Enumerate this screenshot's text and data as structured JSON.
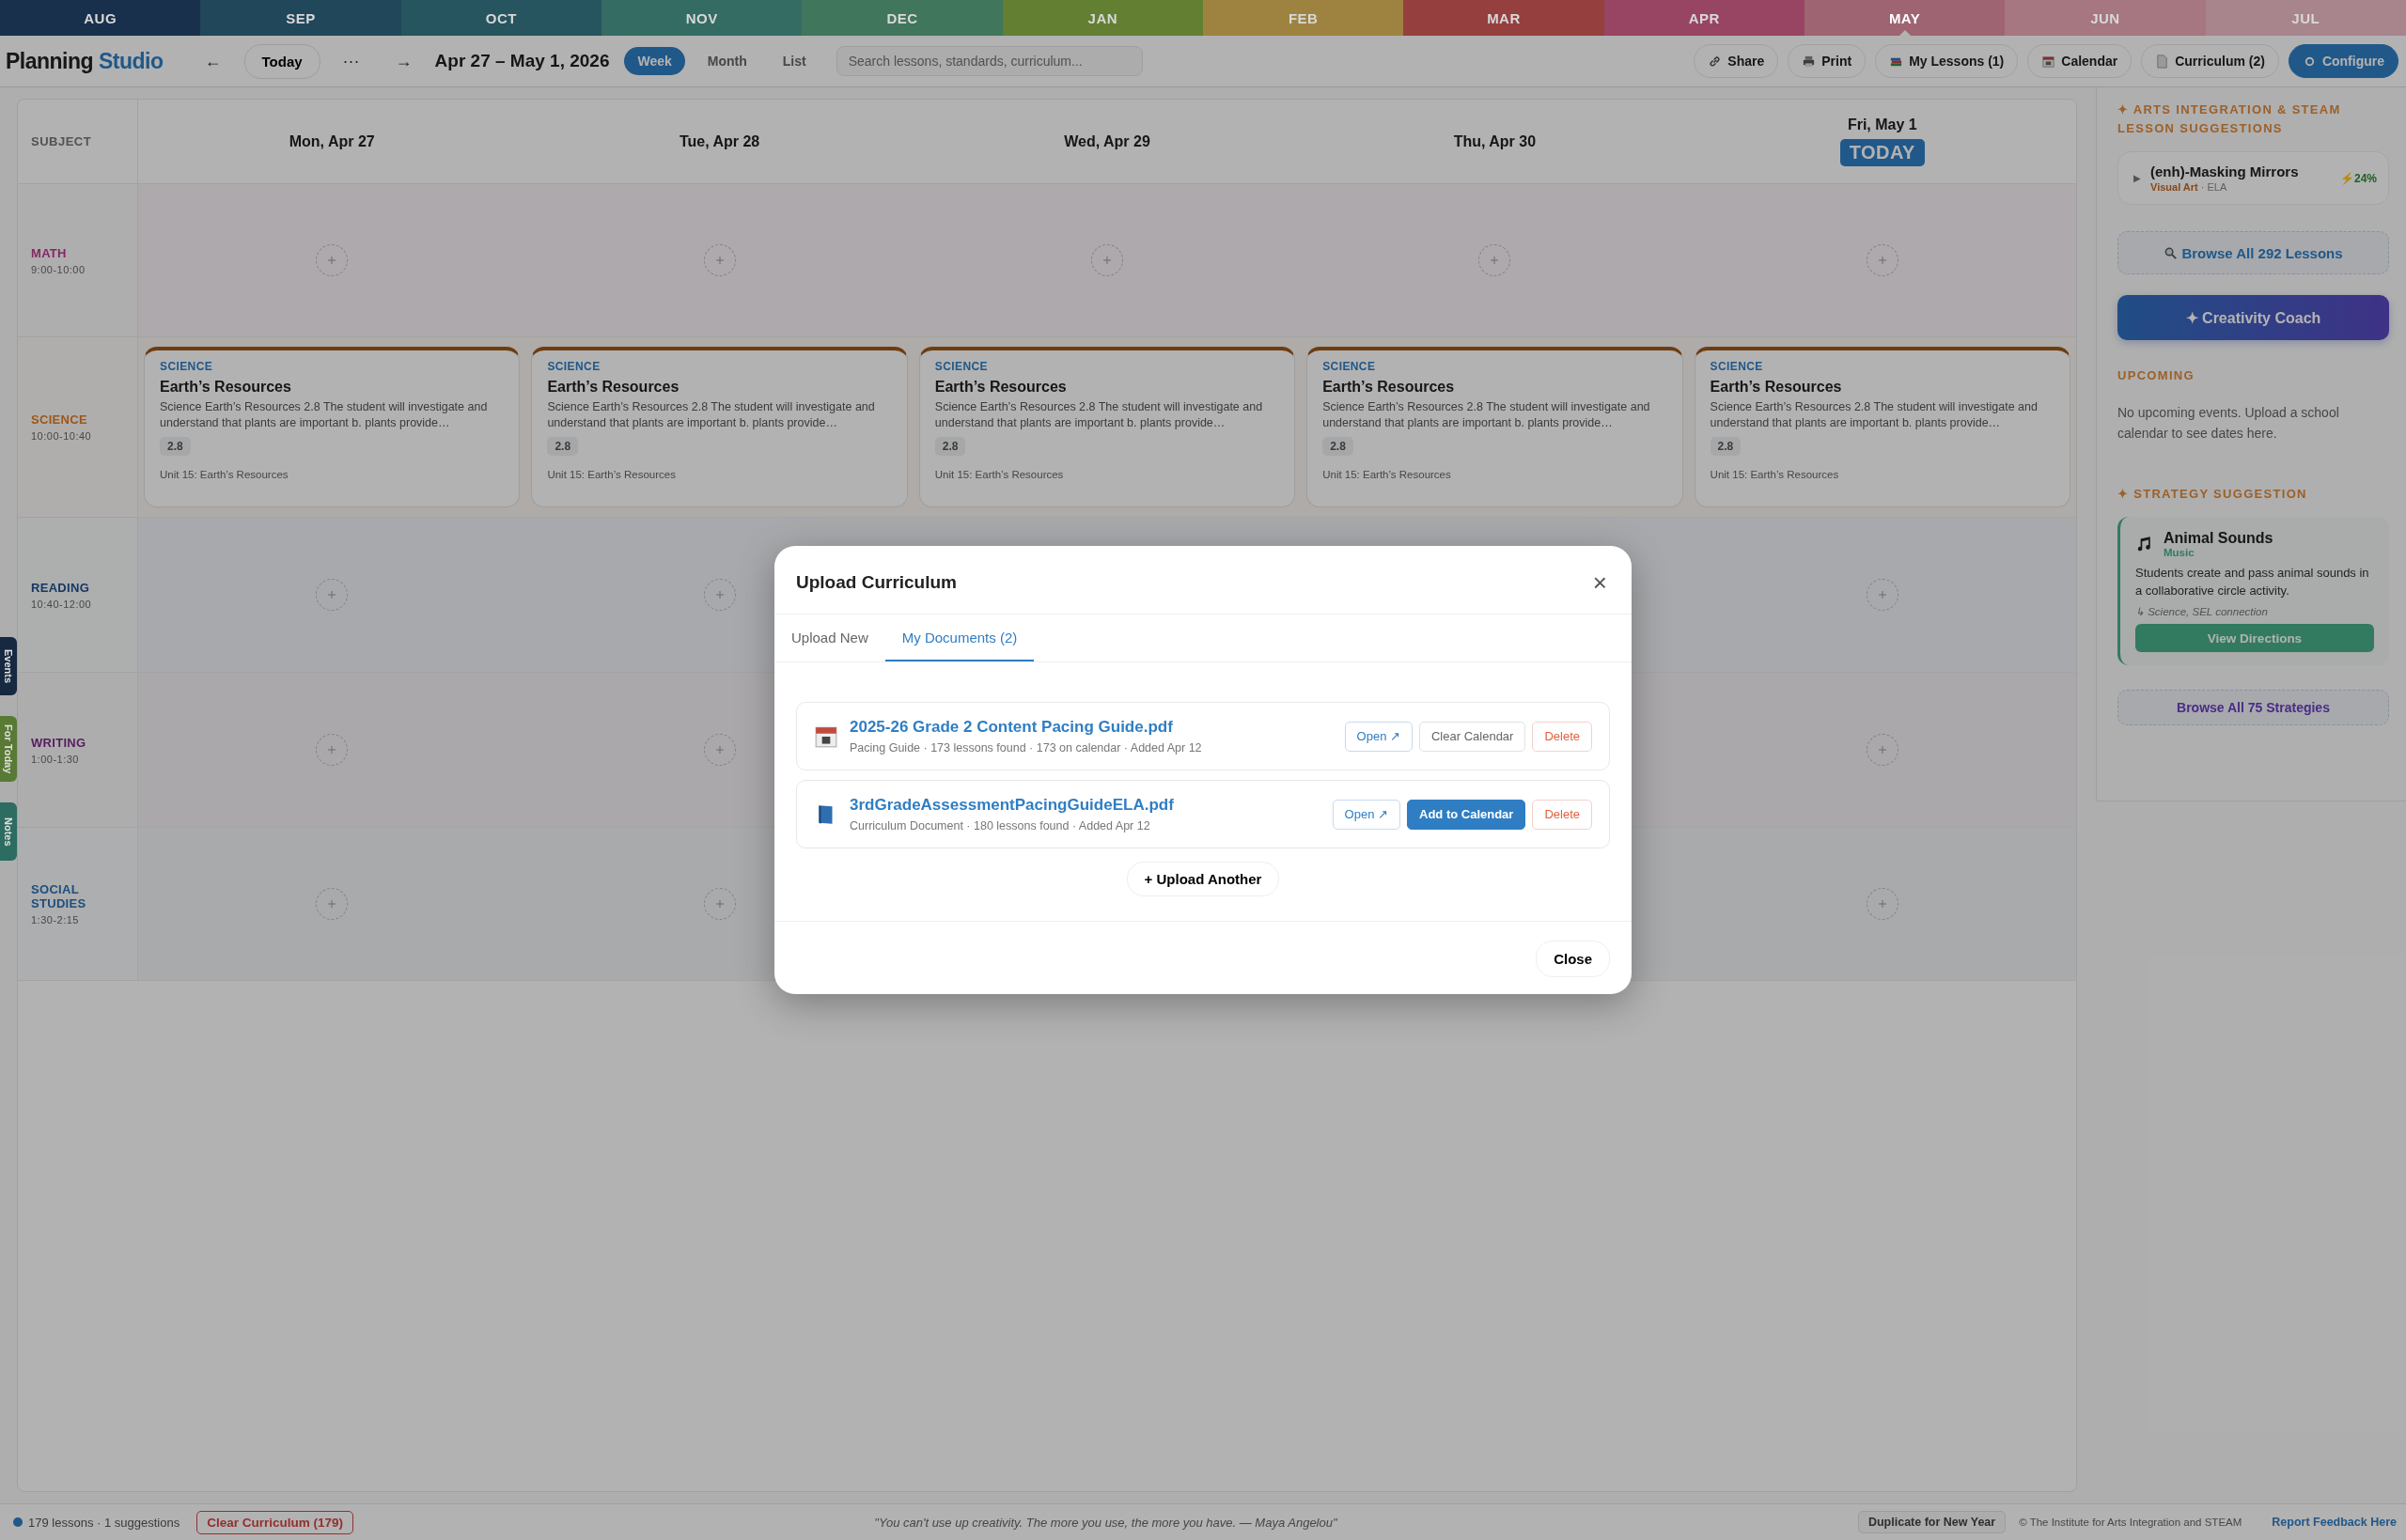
{
  "months": [
    {
      "label": "AUG",
      "color": "#18304b",
      "selected": false
    },
    {
      "label": "SEP",
      "color": "#20475a",
      "selected": false
    },
    {
      "label": "OCT",
      "color": "#26545f",
      "selected": false
    },
    {
      "label": "NOV",
      "color": "#346c63",
      "selected": false
    },
    {
      "label": "DEC",
      "color": "#40765c",
      "selected": false
    },
    {
      "label": "JAN",
      "color": "#627f32",
      "selected": false
    },
    {
      "label": "FEB",
      "color": "#9e8340",
      "selected": false
    },
    {
      "label": "MAR",
      "color": "#963f3f",
      "selected": false
    },
    {
      "label": "APR",
      "color": "#984563",
      "selected": false
    },
    {
      "label": "MAY",
      "color": "#9f6472",
      "selected": true
    },
    {
      "label": "JUN",
      "color": "#a67681",
      "selected": false
    },
    {
      "label": "JUL",
      "color": "#a8848d",
      "selected": false
    }
  ],
  "toolbar": {
    "brand": "Planning",
    "brand_accent": "Studio",
    "prev": "←",
    "today": "Today",
    "more": "···",
    "next": "→",
    "range": "Apr 27 – May 1, 2026",
    "views": [
      {
        "label": "Week",
        "selected": true
      },
      {
        "label": "Month",
        "selected": false
      },
      {
        "label": "List",
        "selected": false
      }
    ],
    "search": {
      "placeholder": "Search lessons, standards, curriculum..."
    },
    "actions": [
      {
        "label": "Share",
        "kind": "plain"
      },
      {
        "label": "Print",
        "kind": "plain"
      },
      {
        "label": "My Lessons (1)",
        "kind": "plain"
      },
      {
        "label": "Calendar",
        "kind": "plain"
      },
      {
        "label": "Curriculum (2)",
        "kind": "plain"
      },
      {
        "label": "Configure",
        "kind": "primary"
      }
    ]
  },
  "calendar": {
    "corner": "SUBJECT",
    "days": [
      {
        "label": "Mon, Apr 27"
      },
      {
        "label": "Tue, Apr 28"
      },
      {
        "label": "Wed, Apr 29"
      },
      {
        "label": "Thu, Apr 30"
      },
      {
        "label": "Fri, May 1",
        "badge": "TODAY"
      }
    ],
    "rows": [
      {
        "subject": "MATH",
        "time": "9:00-10:00",
        "color": "#862764",
        "cells": [
          {
            "kind": "add"
          },
          {
            "kind": "add"
          },
          {
            "kind": "add"
          },
          {
            "kind": "add"
          },
          {
            "kind": "add"
          }
        ]
      },
      {
        "subject": "SCIENCE",
        "time": "10:00-10:40",
        "color": "#9d5618",
        "cells": [
          {
            "kind": "lesson",
            "tag": "SCIENCE",
            "title": "Earth’s Resources",
            "text": "Science Earth’s Resources 2.8 The student will investigate and understand that plants are important b. plants provide…",
            "code": "2.8",
            "unit": "Unit 15: Earth’s Resources"
          },
          {
            "kind": "lesson",
            "tag": "SCIENCE",
            "title": "Earth’s Resources",
            "text": "Science Earth’s Resources 2.8 The student will investigate and understand that plants are important b. plants provide…",
            "code": "2.8",
            "unit": "Unit 15: Earth’s Resources"
          },
          {
            "kind": "lesson",
            "tag": "SCIENCE",
            "title": "Earth’s Resources",
            "text": "Science Earth’s Resources 2.8 The student will investigate and understand that plants are important b. plants provide…",
            "code": "2.8",
            "unit": "Unit 15: Earth’s Resources"
          },
          {
            "kind": "lesson",
            "tag": "SCIENCE",
            "title": "Earth’s Resources",
            "text": "Science Earth’s Resources 2.8 The student will investigate and understand that plants are important b. plants provide…",
            "code": "2.8",
            "unit": "Unit 15: Earth’s Resources"
          },
          {
            "kind": "lesson",
            "tag": "SCIENCE",
            "title": "Earth’s Resources",
            "text": "Science Earth’s Resources 2.8 The student will investigate and understand that plants are important b. plants provide…",
            "code": "2.8",
            "unit": "Unit 15: Earth’s Resources"
          }
        ]
      },
      {
        "subject": "READING",
        "time": "10:40-12:00",
        "color": "#163764",
        "cells": [
          {
            "kind": "add"
          },
          {
            "kind": "add"
          },
          {
            "kind": "blank"
          },
          {
            "kind": "blank"
          },
          {
            "kind": "add"
          }
        ]
      },
      {
        "subject": "WRITING",
        "time": "1:00-1:30",
        "color": "#571d5e",
        "cells": [
          {
            "kind": "add"
          },
          {
            "kind": "add"
          },
          {
            "kind": "hidden"
          },
          {
            "kind": "blank"
          },
          {
            "kind": "add"
          }
        ]
      },
      {
        "subject": "SOCIAL STUDIES",
        "time": "1:30-2:15",
        "color": "#1d4e7f",
        "cells": [
          {
            "kind": "add"
          },
          {
            "kind": "add"
          },
          {
            "kind": "hidden"
          },
          {
            "kind": "blank"
          },
          {
            "kind": "add"
          }
        ]
      }
    ]
  },
  "side_tabs": [
    {
      "label": "Events",
      "color": "#162940"
    },
    {
      "label": "For Today",
      "color": "#597a34"
    },
    {
      "label": "Notes",
      "color": "#2c6c61"
    }
  ],
  "sidebar": {
    "suggestions_title": "✦ ARTS INTEGRATION & STEAM LESSON SUGGESTIONS",
    "suggestion": {
      "toggle": "▶",
      "title": "(enh)-Masking Mirrors",
      "art": "Visual Art",
      "subject": "· ELA",
      "score": "⚡24%"
    },
    "browse_lessons": "Browse All 292 Lessons",
    "coach": "✦ Creativity Coach",
    "upcoming_title": "UPCOMING",
    "upcoming_text": "No upcoming events. Upload a school calendar to see dates here.",
    "strategy_title": "✦ STRATEGY SUGGESTION",
    "strategy": {
      "title": "Animal Sounds",
      "category": "Music",
      "text": "Students create and pass animal sounds in a collaborative circle activity.",
      "link": "↳ Science, SEL connection",
      "button": "View Directions"
    },
    "browse_strategies": "Browse All 75 Strategies"
  },
  "footer": {
    "stats": "179 lessons · 1 suggestions",
    "clear": "Clear Curriculum (179)",
    "quote": "\"You can't use up creativity. The more you use, the more you have. — Maya Angelou\"",
    "duplicate": "Duplicate for New Year",
    "copyright": "© The Institute for Arts Integration and STEAM",
    "feedback": "Report Feedback Here"
  },
  "modal": {
    "title": "Upload Curriculum",
    "close_icon": "×",
    "tabs": [
      {
        "label": "Upload New",
        "selected": false
      },
      {
        "label": "My Documents (2)",
        "selected": true
      }
    ],
    "documents": [
      {
        "name": "2025-26 Grade 2 Content Pacing Guide.pdf",
        "meta": "Pacing Guide · 173 lessons found · 173 on calendar · Added Apr 12",
        "actions": [
          {
            "label": "Open ↗",
            "kind": "outline"
          },
          {
            "label": "Clear Calendar",
            "kind": "plain"
          },
          {
            "label": "Delete",
            "kind": "danger"
          }
        ]
      },
      {
        "name": "3rdGradeAssessmentPacingGuideELA.pdf",
        "meta": "Curriculum Document · 180 lessons found · Added Apr 12",
        "actions": [
          {
            "label": "Open ↗",
            "kind": "outline"
          },
          {
            "label": "Add to Calendar",
            "kind": "primary"
          },
          {
            "label": "Delete",
            "kind": "danger"
          }
        ]
      }
    ],
    "upload_another": "+ Upload Another",
    "close": "Close"
  }
}
